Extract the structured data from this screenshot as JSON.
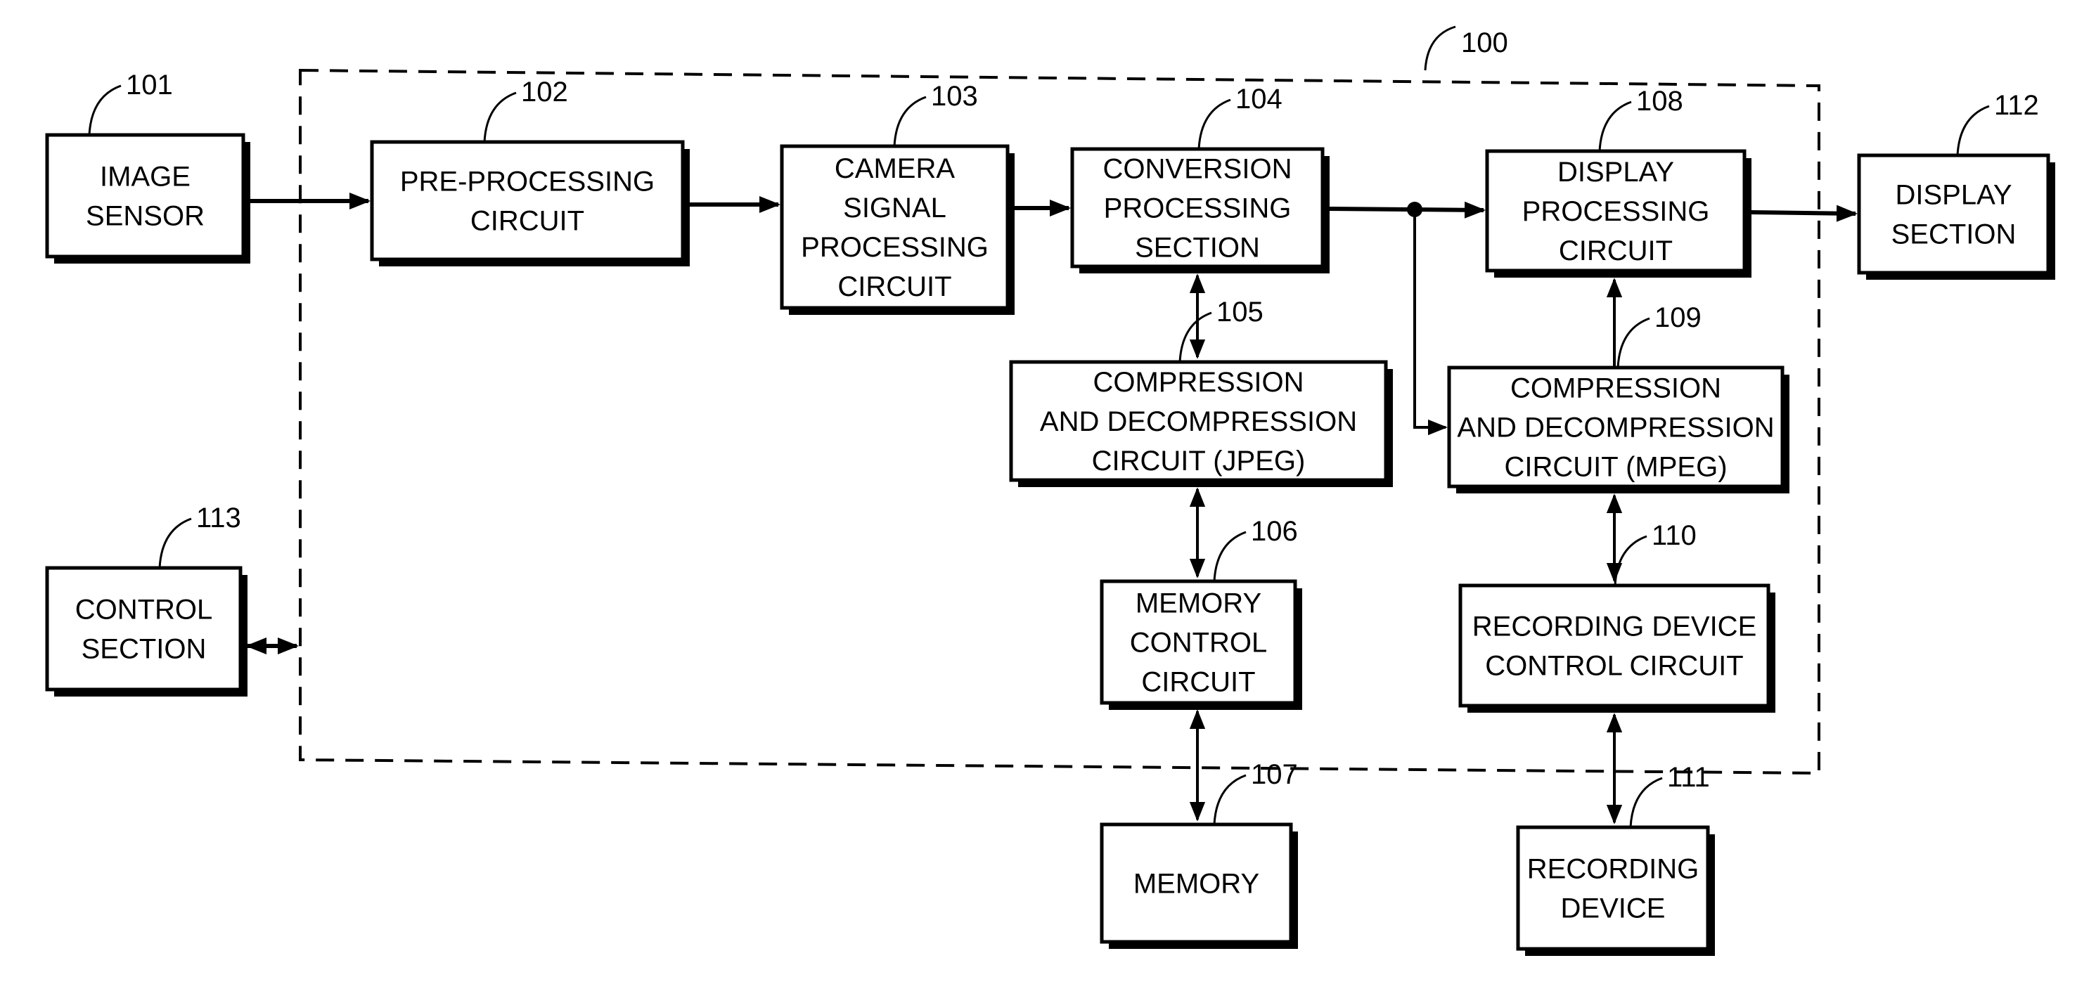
{
  "figure": {
    "enclosure": {
      "ref": "100"
    },
    "blocks": [
      {
        "id": "image-sensor",
        "ref": "101",
        "lines": [
          "IMAGE",
          "SENSOR"
        ]
      },
      {
        "id": "pre-processing-circuit",
        "ref": "102",
        "lines": [
          "PRE-PROCESSING",
          "CIRCUIT"
        ]
      },
      {
        "id": "camera-signal-processing-circuit",
        "ref": "103",
        "lines": [
          "CAMERA",
          "SIGNAL",
          "PROCESSING",
          "CIRCUIT"
        ]
      },
      {
        "id": "conversion-processing-section",
        "ref": "104",
        "lines": [
          "CONVERSION",
          "PROCESSING",
          "SECTION"
        ]
      },
      {
        "id": "jpeg-codec-circuit",
        "ref": "105",
        "lines": [
          "COMPRESSION",
          "AND DECOMPRESSION",
          "CIRCUIT (JPEG)"
        ]
      },
      {
        "id": "memory-control-circuit",
        "ref": "106",
        "lines": [
          "MEMORY",
          "CONTROL",
          "CIRCUIT"
        ]
      },
      {
        "id": "memory",
        "ref": "107",
        "lines": [
          "MEMORY"
        ]
      },
      {
        "id": "display-processing-circuit",
        "ref": "108",
        "lines": [
          "DISPLAY",
          "PROCESSING",
          "CIRCUIT"
        ]
      },
      {
        "id": "mpeg-codec-circuit",
        "ref": "109",
        "lines": [
          "COMPRESSION",
          "AND DECOMPRESSION",
          "CIRCUIT (MPEG)"
        ]
      },
      {
        "id": "recording-device-control-circuit",
        "ref": "110",
        "lines": [
          "RECORDING DEVICE",
          "CONTROL CIRCUIT"
        ]
      },
      {
        "id": "recording-device",
        "ref": "111",
        "lines": [
          "RECORDING",
          "DEVICE"
        ]
      },
      {
        "id": "display-section",
        "ref": "112",
        "lines": [
          "DISPLAY",
          "SECTION"
        ]
      },
      {
        "id": "control-section",
        "ref": "113",
        "lines": [
          "CONTROL",
          "SECTION"
        ]
      }
    ],
    "connections": [
      {
        "from": "101",
        "to": "102",
        "type": "arrow"
      },
      {
        "from": "102",
        "to": "103",
        "type": "arrow"
      },
      {
        "from": "103",
        "to": "104",
        "type": "arrow"
      },
      {
        "from": "104",
        "to": "108",
        "type": "arrow"
      },
      {
        "from": "104",
        "to": "109",
        "type": "arrow",
        "via": "junction"
      },
      {
        "from": "104",
        "to": "105",
        "type": "bidirectional"
      },
      {
        "from": "105",
        "to": "106",
        "type": "bidirectional"
      },
      {
        "from": "106",
        "to": "107",
        "type": "bidirectional"
      },
      {
        "from": "109",
        "to": "108",
        "type": "arrow"
      },
      {
        "from": "109",
        "to": "110",
        "type": "bidirectional"
      },
      {
        "from": "110",
        "to": "111",
        "type": "bidirectional"
      },
      {
        "from": "108",
        "to": "112",
        "type": "arrow"
      },
      {
        "from": "113",
        "to": "100",
        "type": "bidirectional"
      }
    ]
  }
}
